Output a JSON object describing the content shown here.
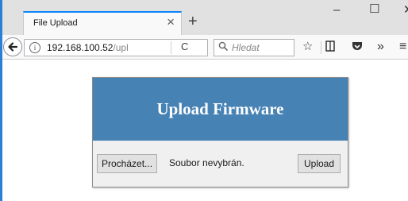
{
  "browser": {
    "tab_title": "File Upload",
    "tab_close_icon": "×",
    "new_tab_icon": "+",
    "window_controls": {
      "minimize": "–",
      "maximize": "☐",
      "close": "✕"
    },
    "url_host": "192.168.100.52",
    "url_path": "/upl",
    "search_placeholder": "Hledat",
    "toolbar_icons": [
      "star-icon",
      "library-icon",
      "pocket-icon",
      "overflow-icon",
      "menu-icon"
    ],
    "accent_color": "#0a84ff"
  },
  "page": {
    "title": "Upload Firmware",
    "header_color": "#4682b4",
    "browse_label": "Procházet...",
    "no_file_text": "Soubor nevybrán.",
    "upload_label": "Upload"
  }
}
